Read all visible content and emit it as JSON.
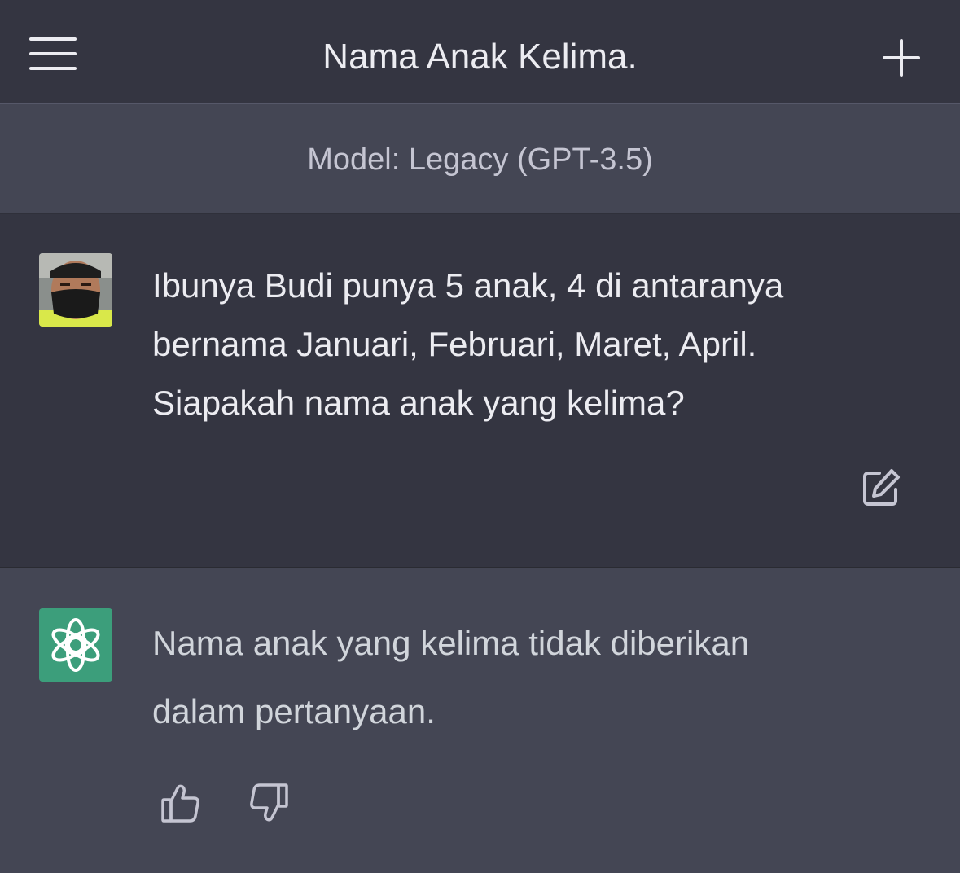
{
  "header": {
    "title": "Nama Anak Kelima.",
    "menu_icon": "hamburger-menu-icon",
    "new_chat_icon": "plus-icon"
  },
  "model_banner": {
    "text": "Model: Legacy (GPT-3.5)"
  },
  "conversation": {
    "user_message": {
      "avatar": "user-photo-avatar",
      "lines": [
        "Ibunya Budi punya 5 anak, 4 di antaranya",
        "bernama Januari, Februari, Maret, April.",
        "Siapakah nama anak yang kelima?"
      ],
      "edit_icon": "edit-pencil-icon"
    },
    "assistant_message": {
      "avatar": "openai-logo-icon",
      "lines": [
        "Nama anak yang kelima tidak diberikan",
        "dalam pertanyaan."
      ],
      "feedback_icons": [
        "thumbs-up-icon",
        "thumbs-down-icon"
      ]
    }
  },
  "colors": {
    "header_bg": "#343541",
    "banner_bg": "#444654",
    "assistant_avatar_bg": "#3c9e7b",
    "text_primary": "#ececf1",
    "text_muted": "#c5c5d2"
  }
}
